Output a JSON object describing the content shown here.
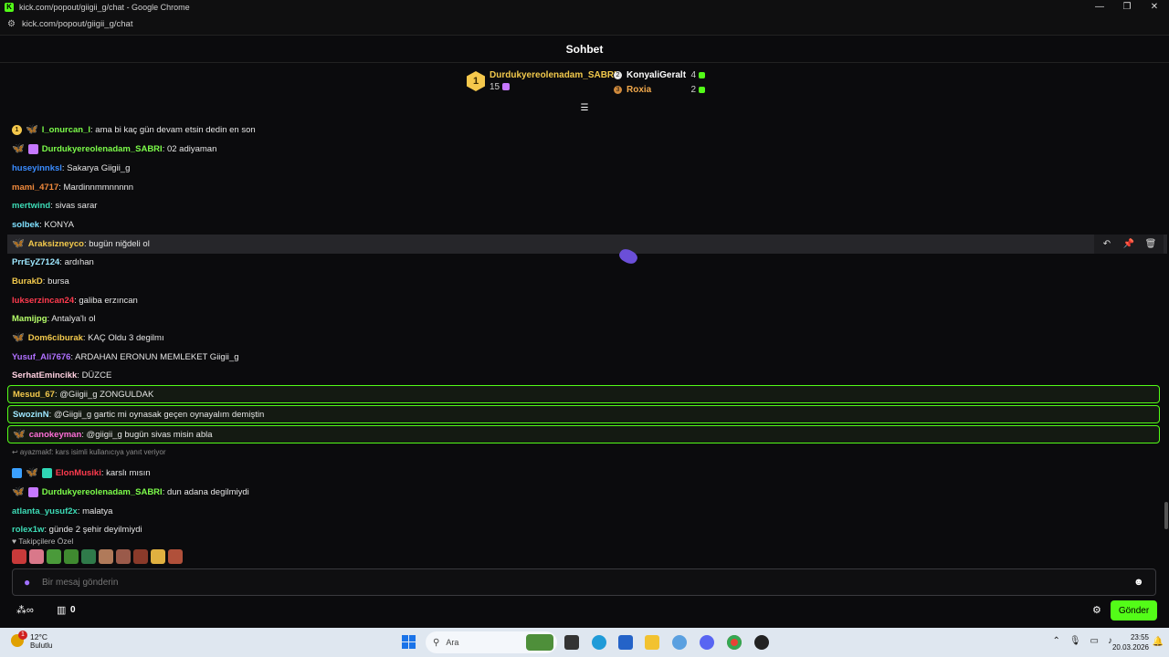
{
  "browser": {
    "title": "kick.com/popout/giigii_g/chat - Google Chrome",
    "url": "kick.com/popout/giigii_g/chat"
  },
  "chat": {
    "header_title": "Sohbet",
    "leaderboard": {
      "first": {
        "rank": "1",
        "name": "Durdukyereolenadam_SABRI",
        "count": "15"
      },
      "others": [
        {
          "name": "KonyaliGeralt",
          "count": "4",
          "color": "#ffffff"
        },
        {
          "name": "Roxia",
          "count": "2",
          "color": "#f2a94c"
        }
      ]
    },
    "messages": [
      {
        "user": "l_onurcan_l",
        "color": "#7cfc4a",
        "text": ": ama bi kaç gün devam etsin dedin en son",
        "badges": [
          "gold",
          "butterfly"
        ]
      },
      {
        "user": "Durdukyereolenadam_SABRI",
        "color": "#7cfc4a",
        "text": ": 02 adiyaman",
        "badges": [
          "butterfly",
          "gift"
        ]
      },
      {
        "user": "huseyinnksl",
        "color": "#3a8cff",
        "text": ": Sakarya Giigii_g",
        "badges": []
      },
      {
        "user": "mami_4717",
        "color": "#f08a3c",
        "text": ": Mardinnmmnnnnn",
        "badges": []
      },
      {
        "user": "mertwind",
        "color": "#3ddbb6",
        "text": ": sivas sarar",
        "badges": []
      },
      {
        "user": "solbek",
        "color": "#7fe0ff",
        "text": ": KONYA",
        "badges": []
      },
      {
        "user": "Araksizneyco",
        "color": "#f2c94c",
        "text": ": bugün niğdeli ol",
        "badges": [
          "butterfly"
        ]
      },
      {
        "user": "PrrEyZ7124",
        "color": "#9ee8ff",
        "text": ": ardıhan",
        "badges": []
      },
      {
        "user": "BurakD",
        "color": "#f2c94c",
        "text": ": bursa",
        "badges": []
      },
      {
        "user": "lukserzincan24",
        "color": "#ff3b4e",
        "text": ": galiba erzıncan",
        "badges": []
      },
      {
        "user": "Mamijpg",
        "color": "#b6ff6a",
        "text": ": Antalya'lı ol",
        "badges": []
      },
      {
        "user": "Dom6ciburak",
        "color": "#f2c94c",
        "text": ": KAÇ Oldu 3 degilmı",
        "badges": [
          "butterfly"
        ]
      },
      {
        "user": "Yusuf_Ali7676",
        "color": "#b070ff",
        "text": ": ARDAHAN ERONUN MEMLEKET Giigii_g",
        "badges": []
      },
      {
        "user": "SerhatEmincikk",
        "color": "#ffd0e0",
        "text": ": DÜZCE",
        "badges": []
      },
      {
        "user": "Mesud_67",
        "color": "#f2c94c",
        "text": ": @Giigii_g ZONGULDAK",
        "badges": []
      },
      {
        "user": "SwozinN",
        "color": "#9ee8ff",
        "text": ": @Giigii_g gartic mi oynasak geçen oynayalım demiştin",
        "badges": []
      },
      {
        "user": "canokeyman",
        "color": "#ff6fd8",
        "text": ": @giigii_g bugün sivas misin abla",
        "badges": [
          "butterfly"
        ]
      },
      {
        "user": "ElonMusiki",
        "color": "#ff3b4e",
        "text": ": karslı mısın",
        "badges": [
          "blue",
          "butterfly",
          "teal"
        ]
      },
      {
        "user": "Durdukyereolenadam_SABRI",
        "color": "#7cfc4a",
        "text": ": dun adana degilmiydi",
        "badges": [
          "butterfly",
          "gift"
        ]
      },
      {
        "user": "atlanta_yusuf2x",
        "color": "#3ddbb6",
        "text": ": malatya",
        "badges": []
      },
      {
        "user": "rolex1w",
        "color": "#3ddbb6",
        "text": ": günde 2 şehir deyilmiydi",
        "badges": []
      }
    ],
    "reply_hint": "ayazmakf: kars isimli kullanıcıya yanıt veriyor",
    "emote_label": "Takipçilere Özel",
    "input_placeholder": "Bir mesaj gönderin",
    "store_count": "0",
    "send_label": "Gönder"
  },
  "taskbar": {
    "weather_temp": "12°C",
    "weather_desc": "Bulutlu",
    "weather_badge": "1",
    "search_label": "Ara",
    "time": "23:55",
    "date": "20.03.2026"
  }
}
